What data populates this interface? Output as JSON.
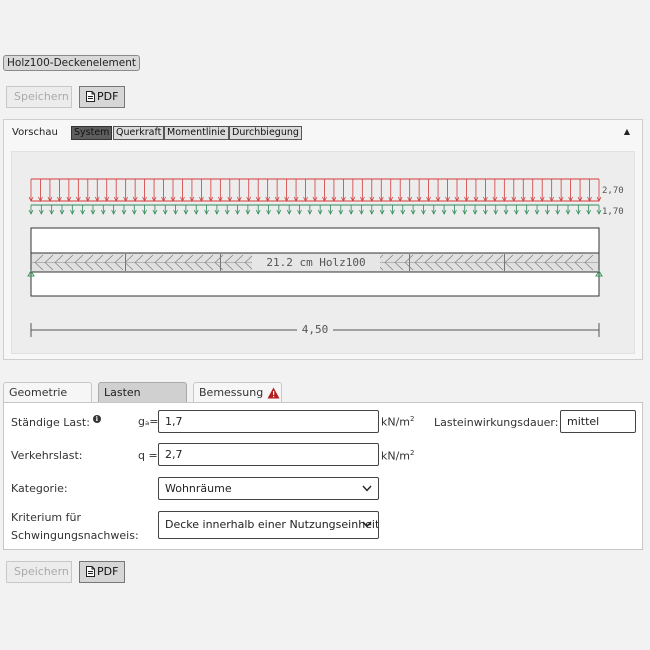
{
  "element_tag": "Holz100-Deckenelement",
  "toolbar_top": {
    "save_label": "Speichern",
    "pdf_label": "PDF"
  },
  "preview": {
    "title": "Vorschau",
    "tabs": [
      {
        "label": "System",
        "active": true
      },
      {
        "label": "Querkraft",
        "active": false
      },
      {
        "label": "Momentlinie",
        "active": false
      },
      {
        "label": "Durchbiegung",
        "active": false
      }
    ],
    "load_label_upper": "2,70",
    "load_label_lower": "1,70",
    "section_label": "21.2 cm Holz100",
    "span_label": "4,50",
    "colors": {
      "variable_load": "#d23a3a",
      "permanent_load": "#2f8a5a",
      "support": "#3a9a5a"
    }
  },
  "tabs": [
    {
      "label": "Geometrie",
      "active": false
    },
    {
      "label": "Lasten",
      "active": true
    },
    {
      "label": "Bemessung",
      "active": false,
      "icon": "warning-icon"
    }
  ],
  "form": {
    "permanent_load": {
      "label": "Ständige Last:",
      "symbol": "gₐ=",
      "value": "1,7",
      "unit": "kN/m",
      "unit_exp": "2"
    },
    "duration": {
      "label": "Lasteinwirkungsdauer:",
      "value": "mittel"
    },
    "live_load": {
      "label": "Verkehrslast:",
      "symbol": "q =",
      "value": "2,7",
      "unit": "kN/m",
      "unit_exp": "2"
    },
    "category": {
      "label": "Kategorie:",
      "value": "Wohnräume"
    },
    "criterion": {
      "label_line1": "Kriterium für",
      "label_line2": "Schwingungsnachweis:",
      "value": "Decke innerhalb einer Nutzungseinheit"
    },
    "info_glyph": "i"
  },
  "toolbar_bottom": {
    "save_label": "Speichern",
    "pdf_label": "PDF"
  }
}
